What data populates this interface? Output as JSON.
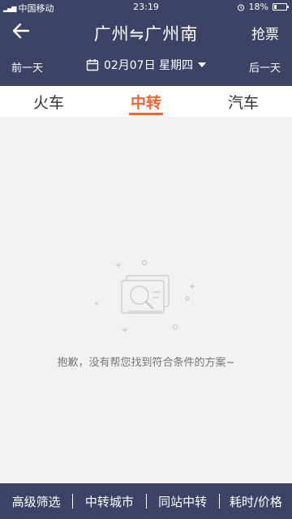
{
  "status_bar": {
    "carrier": "中国移动",
    "time": "23:19",
    "battery": "18%",
    "battery_level": 0.18
  },
  "header": {
    "title": "广州⇋广州南",
    "grab_ticket": "抢票",
    "prev_day": "前一天",
    "next_day": "后一天",
    "date": "02月07日 星期四"
  },
  "tabs": [
    {
      "label": "火车",
      "active": false
    },
    {
      "label": "中转",
      "active": true
    },
    {
      "label": "汽车",
      "active": false
    }
  ],
  "empty_state": {
    "message": "抱歉，没有帮您找到符合条件的方案~"
  },
  "bottom_bar": {
    "items": [
      "高级筛选",
      "中转城市",
      "同站中转",
      "耗时/价格"
    ]
  },
  "colors": {
    "header_bg": "#3c4365",
    "accent": "#f26430",
    "page_bg": "#f2f2f2"
  }
}
